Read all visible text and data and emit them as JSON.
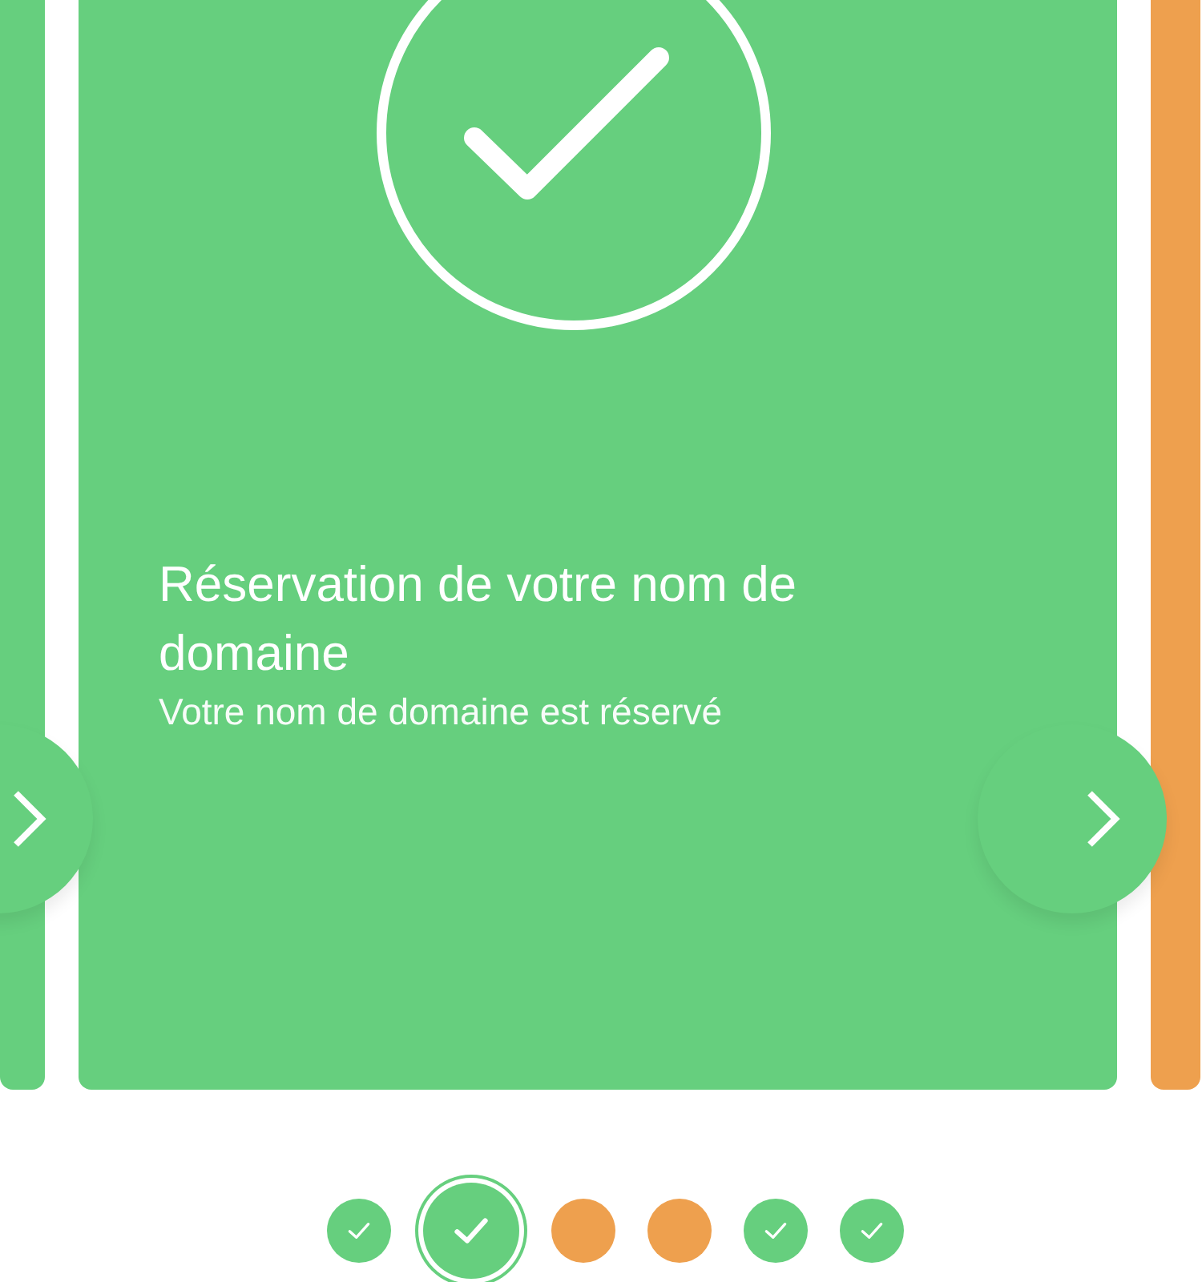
{
  "cards": [
    {
      "kind": "done"
    },
    {
      "kind": "done",
      "title": "Réservation de votre nom de domaine",
      "subtitle": "Votre nom de domaine est réservé"
    },
    {
      "kind": "pending"
    }
  ],
  "steps": [
    {
      "kind": "done",
      "selected": false
    },
    {
      "kind": "done",
      "selected": true
    },
    {
      "kind": "pending",
      "selected": false
    },
    {
      "kind": "pending",
      "selected": false
    },
    {
      "kind": "done",
      "selected": false
    },
    {
      "kind": "done",
      "selected": false
    }
  ]
}
